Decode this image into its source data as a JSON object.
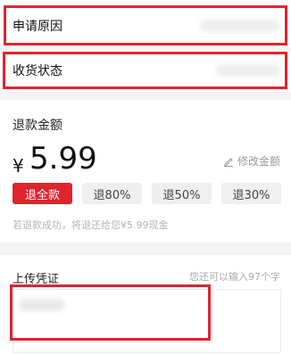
{
  "form": {
    "reason_label": "申请原因",
    "status_label": "收货状态"
  },
  "refund": {
    "title": "退款金额",
    "currency": "¥",
    "amount": "5.99",
    "edit_label": "修改金额",
    "options": [
      {
        "label": "退全款",
        "active": true
      },
      {
        "label": "退80%",
        "active": false
      },
      {
        "label": "退50%",
        "active": false
      },
      {
        "label": "退30%",
        "active": false
      }
    ],
    "hint": "若退款成功，将退还给您¥5.99现金"
  },
  "upload": {
    "title": "上传凭证",
    "remaining": "您还可以输入97个字"
  },
  "colors": {
    "accent": "#e0242c",
    "background": "#f4f4f4"
  },
  "icons": {
    "edit": "pencil-icon"
  }
}
